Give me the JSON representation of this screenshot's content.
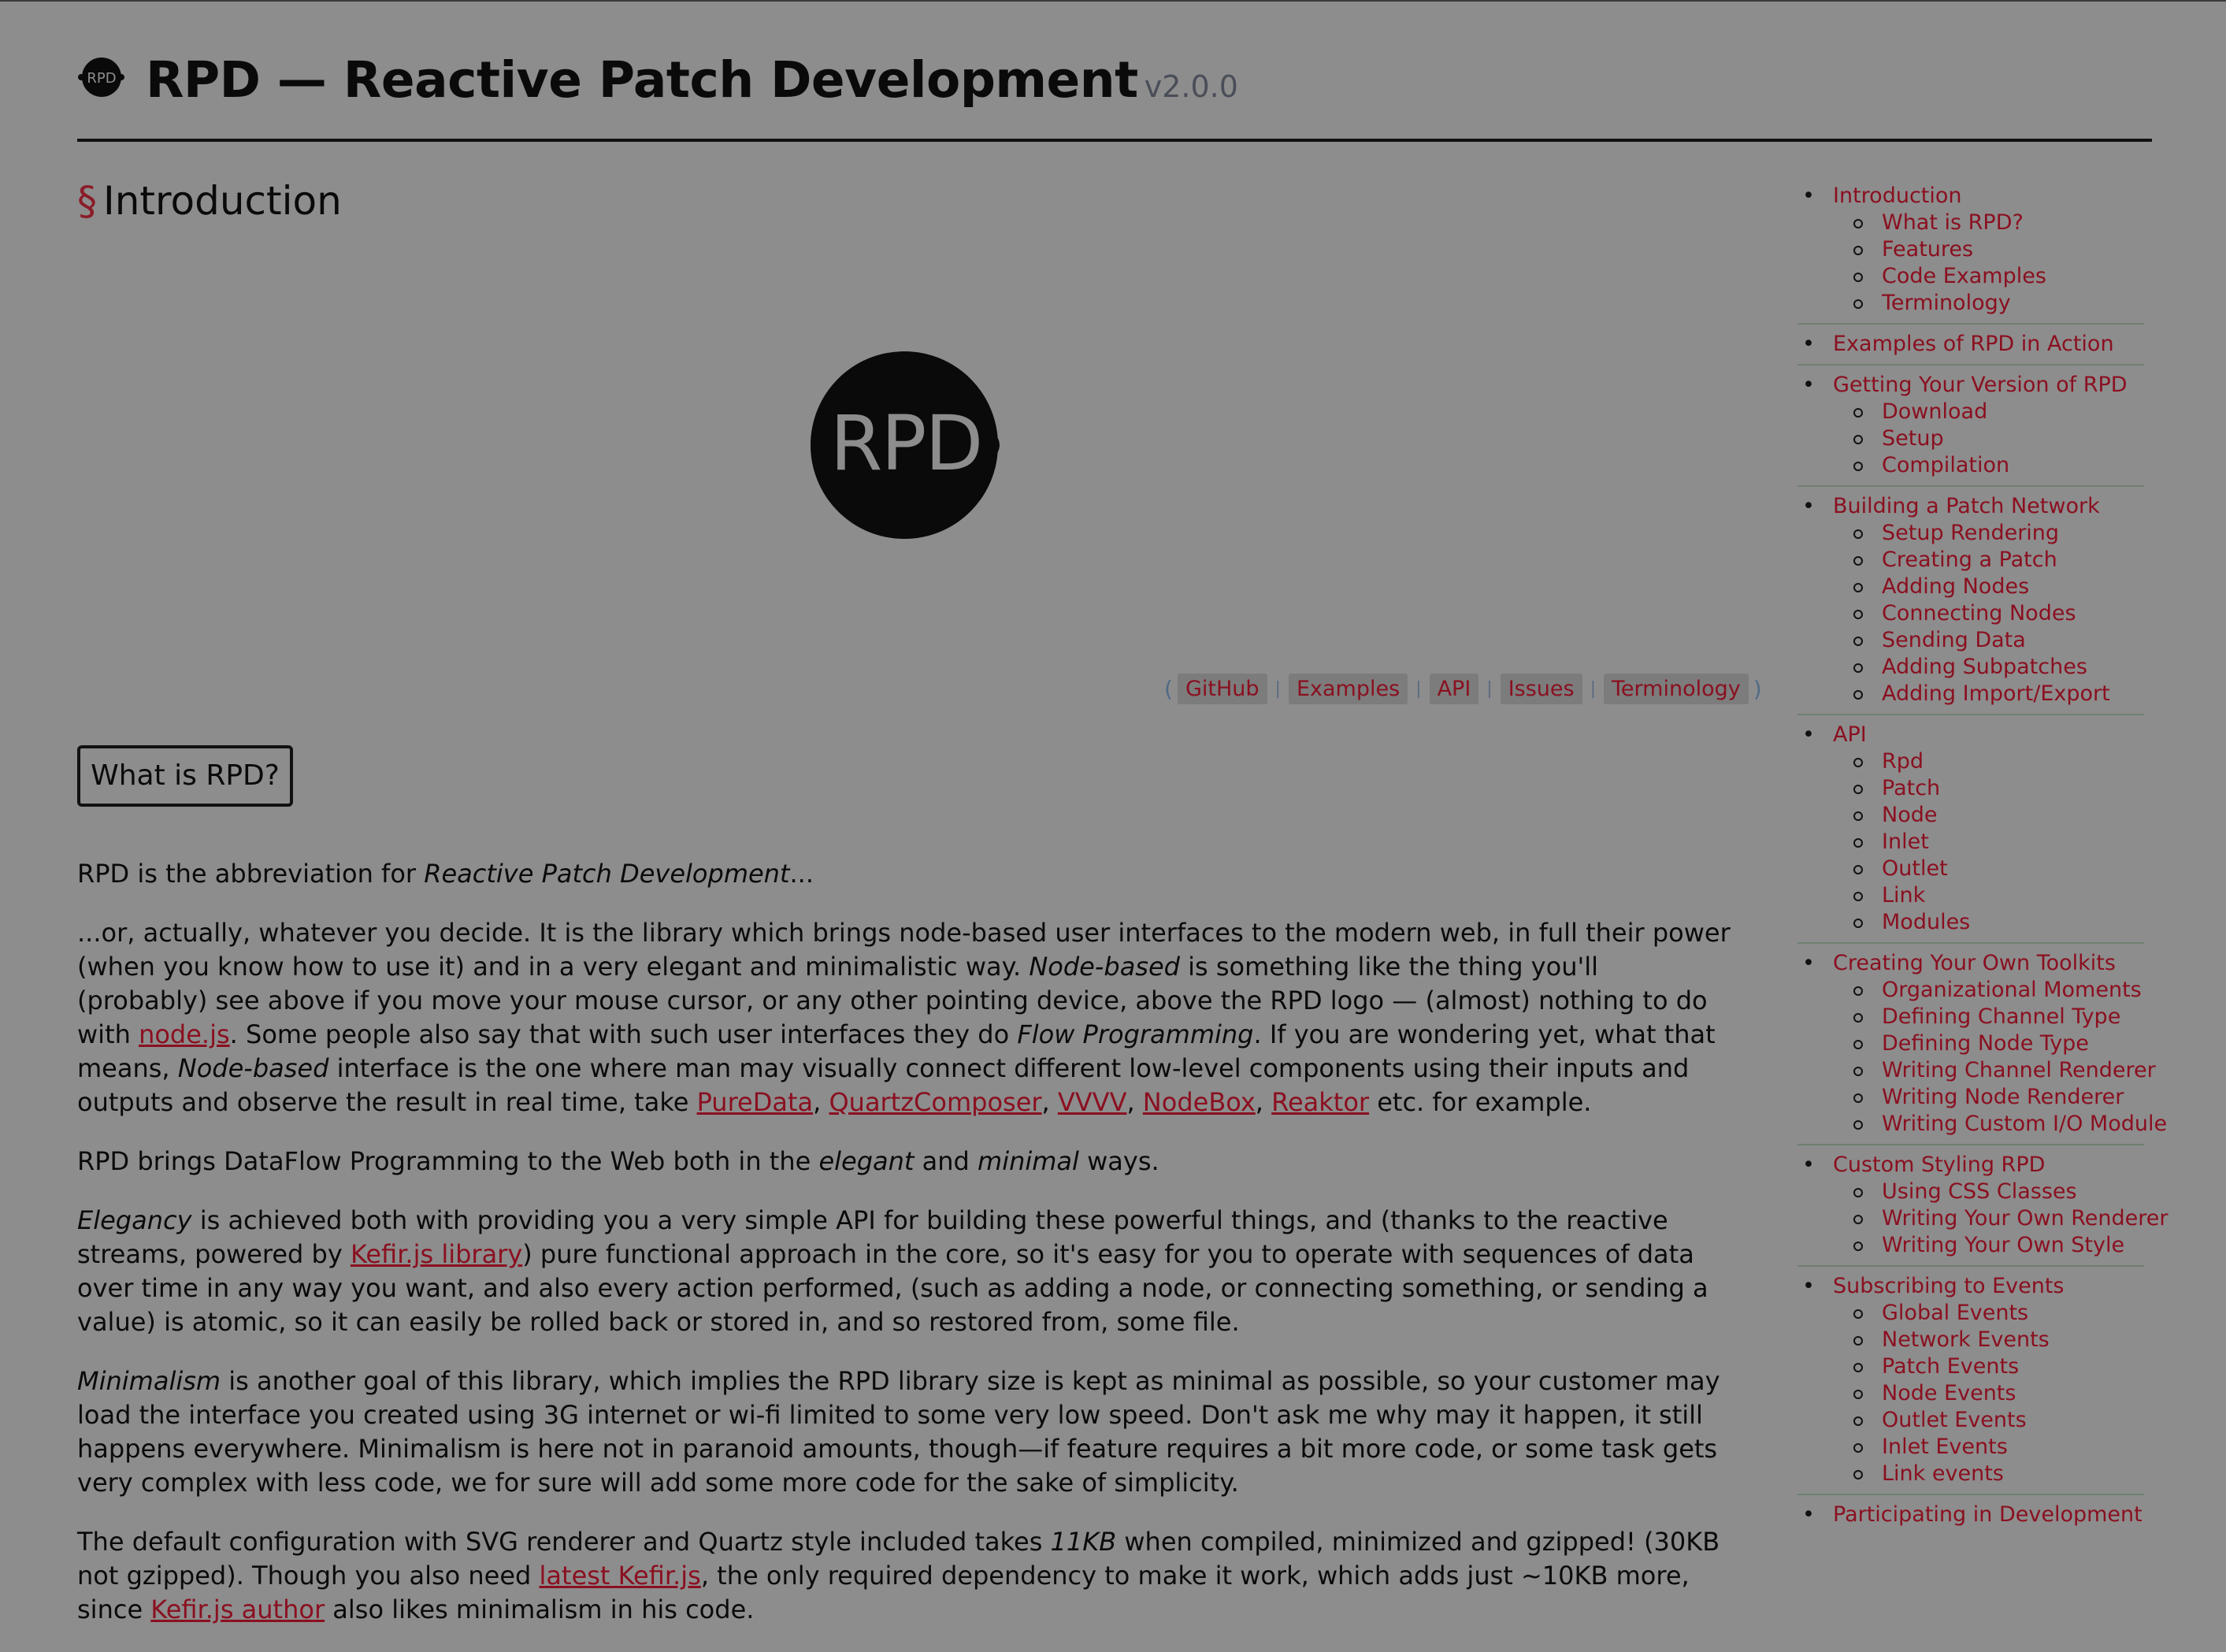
{
  "header": {
    "logo_text": "RPD",
    "title": "RPD — Reactive Patch Development",
    "version": "v2.0.0"
  },
  "section": {
    "mark": "§",
    "title": "Introduction"
  },
  "hero_logo_text": "RPD",
  "quick_links": {
    "open": "(",
    "close": ")",
    "sep": "|",
    "items": [
      "GitHub",
      "Examples",
      "API",
      "Issues",
      "Terminology"
    ]
  },
  "what_is_box": "What is RPD?",
  "paragraphs": {
    "p1": {
      "a": "RPD is the abbreviation for ",
      "b": "Reactive Patch Development",
      "c": "..."
    },
    "p2": {
      "t1": "...or, actually, whatever you decide. It is the library which brings node-based user interfaces to the modern web, in full their power (when you know how to use it) and in a very elegant and minimalistic way. ",
      "i1": "Node-based",
      "t2": " is something like the thing you'll (probably) see above if you move your mouse cursor, or any other pointing device, above the RPD logo — (almost) nothing to do with ",
      "l1": "node.js",
      "t3": ". Some people also say that with such user interfaces they do ",
      "i2": "Flow Programming",
      "t4": ". If you are wondering yet, what that means, ",
      "i3": "Node-based",
      "t5": " interface is the one where man may visually connect different low-level components using their inputs and outputs and observe the result in real time, take ",
      "l2": "PureData",
      "c1": ", ",
      "l3": "QuartzComposer",
      "c2": ", ",
      "l4": "VVVV",
      "c3": ", ",
      "l5": "NodeBox",
      "c4": ", ",
      "l6": "Reaktor",
      "t6": " etc. for example."
    },
    "p3": {
      "a": "RPD brings DataFlow Programming to the Web both in the ",
      "b": "elegant",
      "c": " and ",
      "d": "minimal",
      "e": " ways."
    },
    "p4": {
      "i1": "Elegancy",
      "t1": " is achieved both with providing you a very simple API for building these powerful things, and (thanks to the reactive streams, powered by ",
      "l1": "Kefir.js library",
      "t2": ") pure functional approach in the core, so it's easy for you to operate with sequences of data over time in any way you want, and also every action performed, (such as adding a node, or connecting something, or sending a value) is atomic, so it can easily be rolled back or stored in, and so restored from, some file."
    },
    "p5": {
      "i1": "Minimalism",
      "t1": " is another goal of this library, which implies the RPD library size is kept as minimal as possible, so your customer may load the interface you created using 3G internet or wi-fi limited to some very low speed. Don't ask me why may it happen, it still happens everywhere. Minimalism is here not in paranoid amounts, though—if feature requires a bit more code, or some task gets very complex with less code, we for sure will add some more code for the sake of simplicity."
    },
    "p6": {
      "t1": "The default configuration with SVG renderer and Quartz style included takes ",
      "i1": "11KB",
      "t2": " when compiled, minimized and gzipped! (30KB not gzipped). Though you also need ",
      "l1": "latest Kefir.js",
      "t3": ", the only required dependency to make it work, which adds just ~10KB more, since ",
      "l2": "Kefir.js author",
      "t4": " also likes minimalism in his code."
    }
  },
  "toc": [
    {
      "title": "Introduction",
      "items": [
        "What is RPD?",
        "Features",
        "Code Examples",
        "Terminology"
      ]
    },
    {
      "title": "Examples of RPD in Action",
      "items": []
    },
    {
      "title": "Getting Your Version of RPD",
      "items": [
        "Download",
        "Setup",
        "Compilation"
      ]
    },
    {
      "title": "Building a Patch Network",
      "items": [
        "Setup Rendering",
        "Creating a Patch",
        "Adding Nodes",
        "Connecting Nodes",
        "Sending Data",
        "Adding Subpatches",
        "Adding Import/Export"
      ]
    },
    {
      "title": "API",
      "items": [
        "Rpd",
        "Patch",
        "Node",
        "Inlet",
        "Outlet",
        "Link",
        "Modules"
      ]
    },
    {
      "title": "Creating Your Own Toolkits",
      "items": [
        "Organizational Moments",
        "Defining Channel Type",
        "Defining Node Type",
        "Writing Channel Renderer",
        "Writing Node Renderer",
        "Writing Custom I/O Module"
      ]
    },
    {
      "title": "Custom Styling RPD",
      "items": [
        "Using CSS Classes",
        "Writing Your Own Renderer",
        "Writing Your Own Style"
      ]
    },
    {
      "title": "Subscribing to Events",
      "items": [
        "Global Events",
        "Network Events",
        "Patch Events",
        "Node Events",
        "Outlet Events",
        "Inlet Events",
        "Link events"
      ]
    },
    {
      "title": "Participating in Development",
      "items": []
    }
  ],
  "colors": {
    "background": "#8d8d8d",
    "link": "#8a1020",
    "text": "#0a0a0a"
  }
}
